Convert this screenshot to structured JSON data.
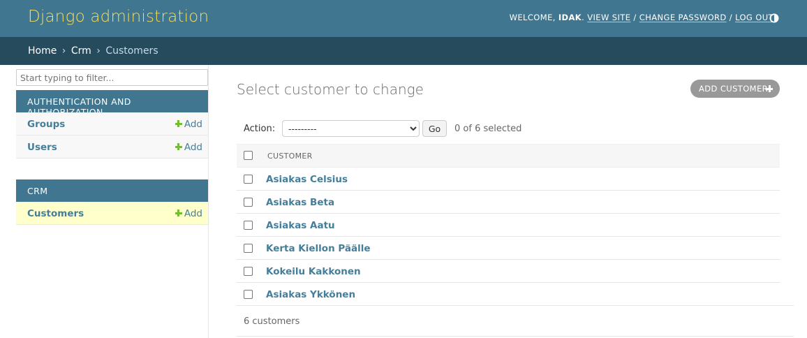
{
  "header": {
    "site_title": "Django administration",
    "welcome_prefix": "WELCOME, ",
    "username": "IDAK",
    "view_site": "VIEW SITE",
    "change_password": "CHANGE PASSWORD",
    "log_out": "LOG OUT",
    "separator": " / ",
    "theme_toggle_icon": "contrast-icon"
  },
  "breadcrumbs": {
    "items": [
      "Home",
      "Crm",
      "Customers"
    ],
    "separator": "›"
  },
  "sidebar": {
    "filter_placeholder": "Start typing to filter...",
    "apps": [
      {
        "caption": "AUTHENTICATION AND AUTHORIZATION",
        "models": [
          {
            "name": "Groups",
            "add": "Add"
          },
          {
            "name": "Users",
            "add": "Add"
          }
        ]
      },
      {
        "caption": "CRM",
        "models": [
          {
            "name": "Customers",
            "add": "Add",
            "current": true
          }
        ]
      }
    ]
  },
  "main": {
    "title": "Select customer to change",
    "add_button": "ADD CUSTOMER",
    "actions": {
      "label": "Action:",
      "selected_option": "---------",
      "go": "Go",
      "selected_count": "0 of 6 selected"
    },
    "table": {
      "columns": [
        "CUSTOMER"
      ],
      "rows": [
        "Asiakas Celsius",
        "Asiakas Beta",
        "Asiakas Aatu",
        "Kerta Kiellon Päälle",
        "Kokeilu Kakkonen",
        "Asiakas Ykkönen"
      ]
    },
    "paginator": "6 customers"
  },
  "colors": {
    "header_bg": "#417690",
    "breadcrumb_bg": "#264b5d",
    "brand_yellow": "#f5dd5d",
    "link": "#447e9b",
    "add_green": "#70bf2b",
    "current_row": "#ffffcc"
  }
}
